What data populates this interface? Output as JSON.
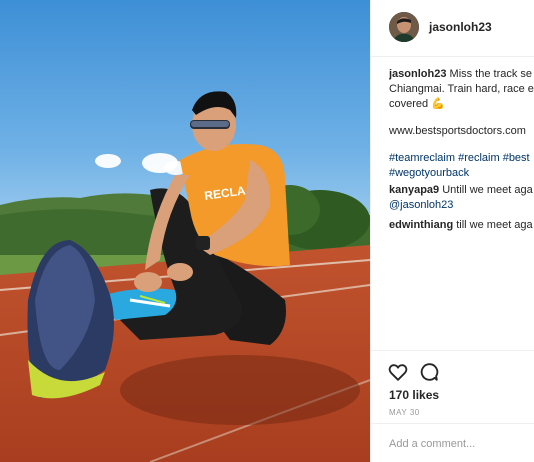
{
  "post": {
    "username": "jasonloh23",
    "caption_user": "jasonloh23",
    "caption_line1": " Miss the track se",
    "caption_line2": "Chiangmai. Train hard, race e",
    "caption_line3": "covered ",
    "caption_emoji": "💪",
    "caption_link": "www.bestsportsdoctors.com",
    "hashtags_line1": "#teamreclaim #reclaim #best",
    "hashtags_line2": "#wegotyourback",
    "photo_shirt_text": "RECLA"
  },
  "comments": [
    {
      "user": "kanyapa9",
      "text": " Untill we meet aga",
      "mention": "@jasonloh23"
    },
    {
      "user": "edwinthiang",
      "text": " till we meet aga"
    }
  ],
  "footer": {
    "likes": "170 likes",
    "date": "MAY 30",
    "add_comment_placeholder": "Add a comment..."
  },
  "icons": {
    "like": "heart-icon",
    "comment": "comment-bubble-icon"
  },
  "colors": {
    "link": "#003569",
    "text": "#262626",
    "muted": "#999999",
    "border": "#efefef"
  }
}
